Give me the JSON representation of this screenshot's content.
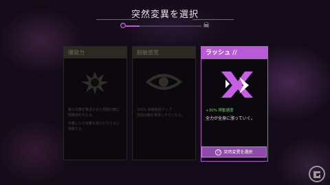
{
  "header": {
    "title": "突然変異を選択",
    "progress": 0.18
  },
  "cards": [
    {
      "title": "爆発力",
      "icon": "explosion-icon",
      "lines": [
        "敵の攻撃を撃退すると周囲の敵に衝撃波を与える。",
        "攻撃したり攻撃を受けたりすると発動する。"
      ]
    },
    {
      "title": "鋭敏感覚",
      "icon": "eye-icon",
      "lines": [
        "100% 索敵範囲アップ",
        "周囲の敵を発見しやすくなる。"
      ]
    },
    {
      "title": "ラッシュ //",
      "icon": "rush-icon",
      "stat": "+30% 移動速度",
      "desc": "全力が全身に漲っていく。"
    }
  ],
  "select_button": {
    "label": "突然変異を選択",
    "icon": "circle-button-icon"
  },
  "watermark": {
    "icon": "gamer-logo-icon"
  },
  "colors": {
    "accent": "#b95ad6",
    "stat": "#6fd06f"
  }
}
